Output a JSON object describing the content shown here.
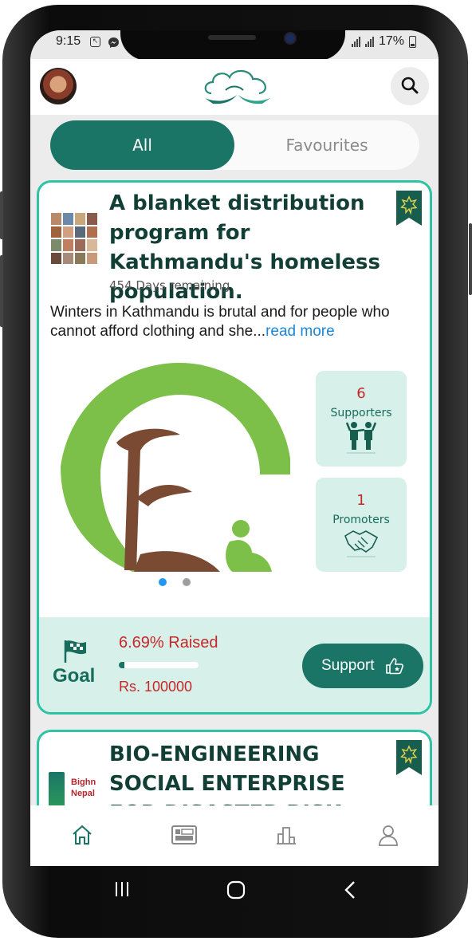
{
  "status_bar": {
    "time": "9:15",
    "battery": "17%",
    "icons": [
      "screenshot-icon",
      "messenger-icon",
      "signal-icon",
      "signal-icon",
      "battery-icon"
    ]
  },
  "header": {
    "avatar": "avatar",
    "logo": "cloud-hands-logo",
    "search_icon": "search-icon"
  },
  "tabs": {
    "all": "All",
    "favourites": "Favourites",
    "selected": "All"
  },
  "campaigns": [
    {
      "title": "A blanket distribution program for Kathmandu's homeless population.",
      "days_remaining": "454 Days remaining",
      "description": "Winters in Kathmandu is brutal and for people who cannot afford clothing and she...",
      "read_more": "read more",
      "supporters_count": "6",
      "supporters_label": "Supporters",
      "promoters_count": "1",
      "promoters_label": "Promoters",
      "carousel": {
        "slides": 2,
        "active": 0
      },
      "raised_text": "6.69%  Raised",
      "raised_fraction": 0.0669,
      "goal_label": "Goal",
      "goal_amount": "Rs. 100000",
      "support_button": "Support"
    },
    {
      "title": "BIO-ENGINEERING SOCIAL ENTERPRISE FOR DISASTER RISK",
      "org_text": "Bighn Nepal"
    }
  ],
  "bottom_nav": [
    "home-icon",
    "gallery-icon",
    "leaderboard-icon",
    "profile-icon"
  ],
  "colors": {
    "primary": "#1a7566",
    "accent_border": "#2fc3a5",
    "light_teal": "#d7f0ea",
    "red": "#c62828",
    "link": "#1a86d9"
  }
}
